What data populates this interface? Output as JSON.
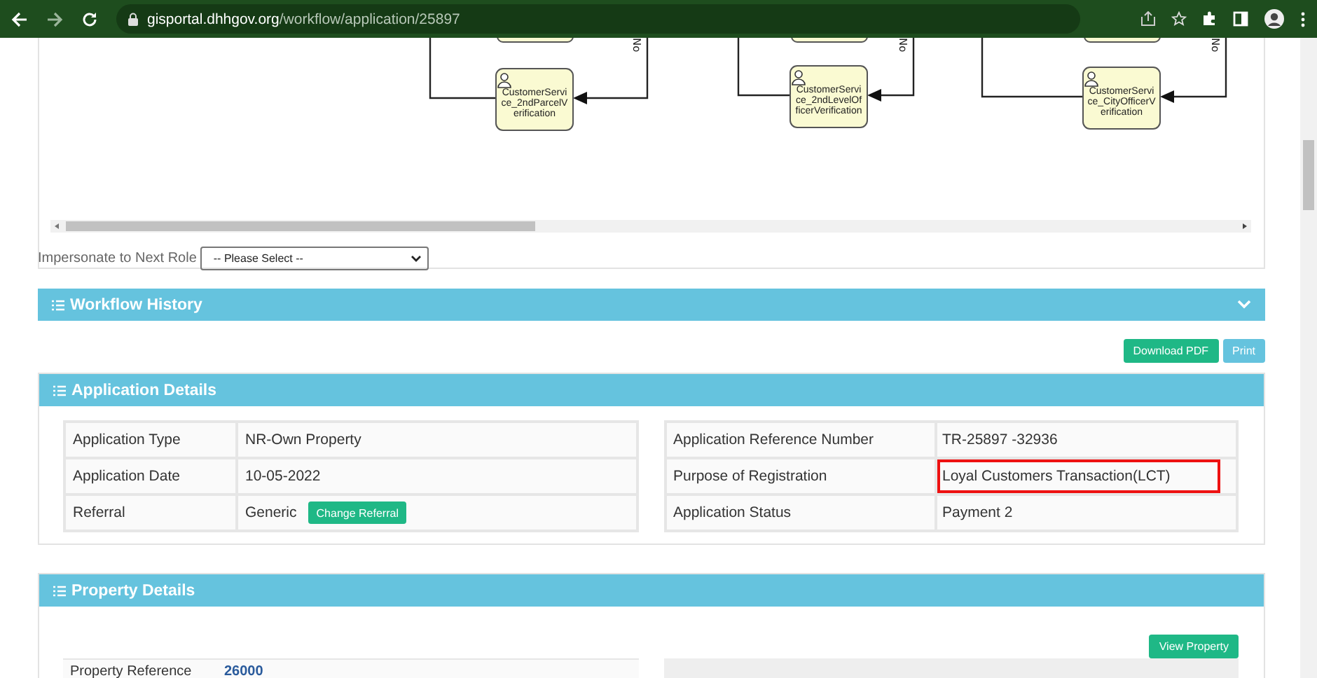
{
  "browser": {
    "url_host": "gisportal.dhhgov.org",
    "url_path": "/workflow/application/25897"
  },
  "workflow_diagram": {
    "nodes": [
      {
        "lines": [
          "CustomerServi",
          "ce_2ndParcelV",
          "erification"
        ],
        "edge_label": "No"
      },
      {
        "lines": [
          "CustomerServi",
          "ce_2ndLevelOf",
          "ficerVerification"
        ],
        "edge_label": "No"
      },
      {
        "lines": [
          "CustomerServi",
          "ce_CityOfficerV",
          "erification"
        ],
        "edge_label": "No"
      }
    ]
  },
  "impersonate": {
    "label": "Impersonate to Next Role",
    "value": "-- Please Select --"
  },
  "workflow_history": {
    "title": "Workflow History",
    "expanded": false
  },
  "actions": [
    {
      "label": "Download PDF",
      "kind": "primary"
    },
    {
      "label": "Print",
      "kind": "secondary"
    }
  ],
  "application_details": {
    "title": "Application Details",
    "left_rows": [
      {
        "label": "Application Type",
        "value": "NR-Own Property"
      },
      {
        "label": "Application Date",
        "value": "10-05-2022"
      },
      {
        "label": "Referral",
        "value": "Generic",
        "button": "Change Referral"
      }
    ],
    "right_rows": [
      {
        "label": "Application Reference Number",
        "value": "TR-25897 -32936",
        "highlighted": false
      },
      {
        "label": "Purpose of Registration",
        "value": "Loyal Customers Transaction(LCT)",
        "highlighted": true
      },
      {
        "label": "Application Status",
        "value": "Payment 2",
        "highlighted": false
      }
    ]
  },
  "property_details": {
    "title": "Property Details",
    "button": "View Property",
    "rows": [
      {
        "label": "Property Reference",
        "value": "26000"
      }
    ]
  }
}
